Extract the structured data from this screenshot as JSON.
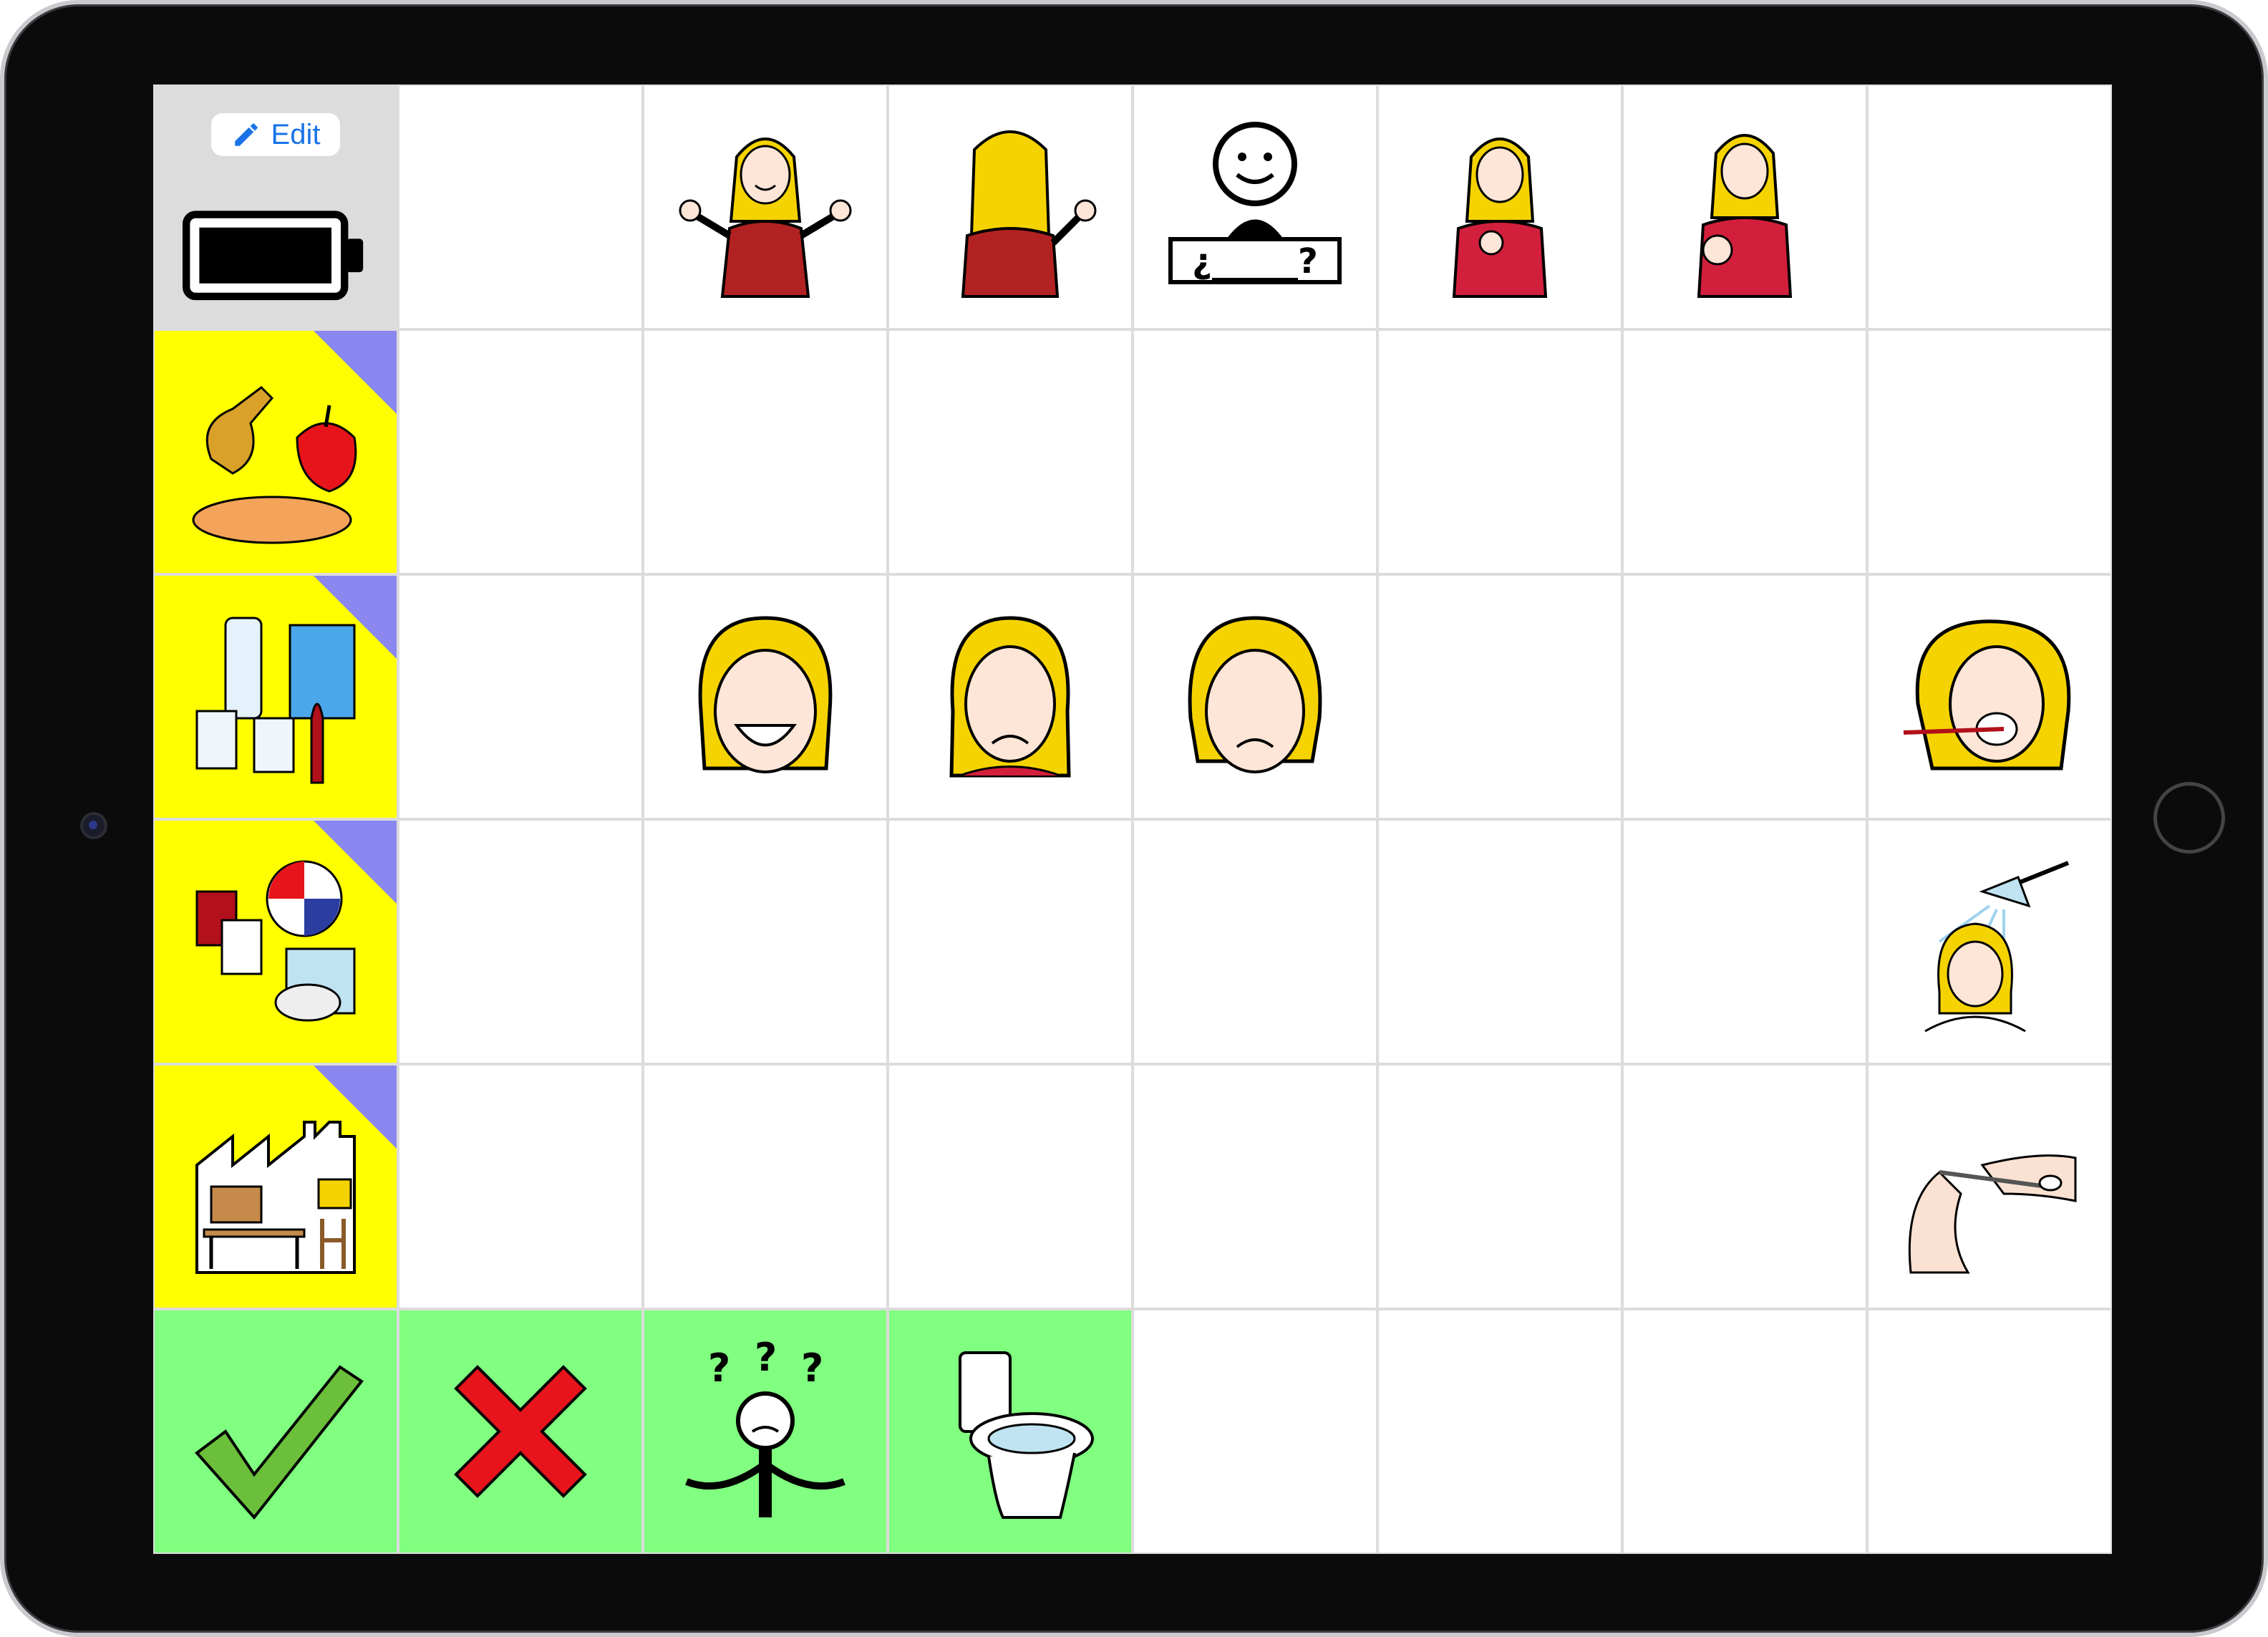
{
  "app": {
    "edit_label": "Edit",
    "pencil_icon": "pencil-icon",
    "battery_icon": "battery-icon"
  },
  "grid": {
    "rows": 6,
    "columns": 8,
    "category_color": "#ffff00",
    "category_corner_color": "#8a87f0",
    "bottom_row_color": "#80ff80",
    "header_cell_color": "#dcdcdc",
    "row1_icons": [
      "",
      "waving-hello-girl-icon",
      "waving-goodbye-girl-icon",
      "question-person-icon",
      "girl-pointing-self-icon",
      "girl-pointing-you-icon",
      ""
    ],
    "categories": [
      "food-category-icon",
      "drinks-category-icon",
      "leisure-category-icon",
      "workshop-category-icon"
    ],
    "row3_icons": [
      "",
      "happy-face-icon",
      "crying-face-icon",
      "sad-face-icon",
      "",
      "",
      "brushing-teeth-icon"
    ],
    "row4_icons": [
      "",
      "",
      "",
      "",
      "",
      "",
      "shower-icon"
    ],
    "row5_icons": [
      "",
      "",
      "",
      "",
      "",
      "",
      "nail-clipping-icon"
    ],
    "bottom_icons": [
      "yes-checkmark-icon",
      "no-cross-icon",
      "confused-person-icon",
      "toilet-icon",
      "",
      "",
      "",
      ""
    ]
  }
}
